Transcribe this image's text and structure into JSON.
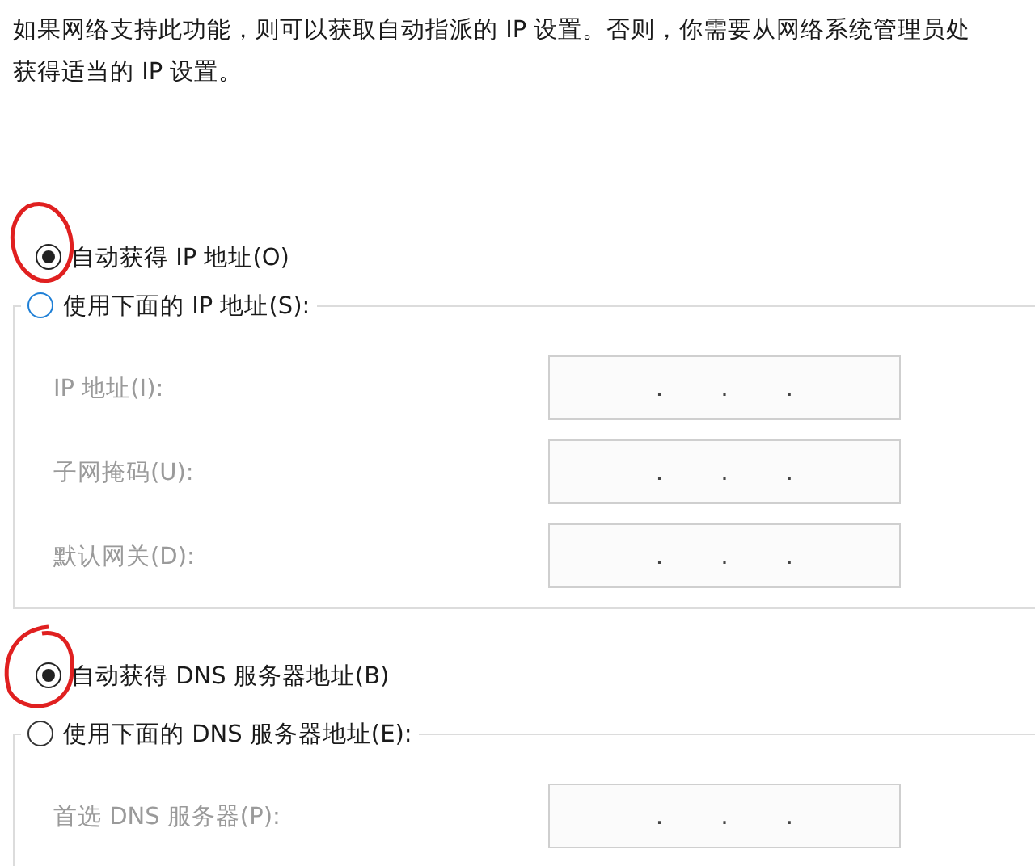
{
  "description": "如果网络支持此功能，则可以获取自动指派的 IP 设置。否则，你需要从网络系统管理员处获得适当的 IP 设置。",
  "ip_mode": [
    {
      "label": "自动获得 IP 地址(O)",
      "selected": true
    },
    {
      "label": "使用下面的 IP 地址(S):",
      "selected": false
    }
  ],
  "ip_fields": [
    {
      "label": "IP 地址(I):",
      "disabled": true,
      "separators": [
        ".",
        ".",
        "."
      ]
    },
    {
      "label": "子网掩码(U):",
      "disabled": true,
      "separators": [
        ".",
        ".",
        "."
      ]
    },
    {
      "label": "默认网关(D):",
      "disabled": true,
      "separators": [
        ".",
        ".",
        "."
      ]
    }
  ],
  "dns_mode": [
    {
      "label": "自动获得 DNS 服务器地址(B)",
      "selected": true
    },
    {
      "label": "使用下面的 DNS 服务器地址(E):",
      "selected": false
    }
  ],
  "dns_fields": [
    {
      "label": "首选 DNS 服务器(P):",
      "disabled": true,
      "separators": [
        ".",
        ".",
        "."
      ]
    }
  ]
}
